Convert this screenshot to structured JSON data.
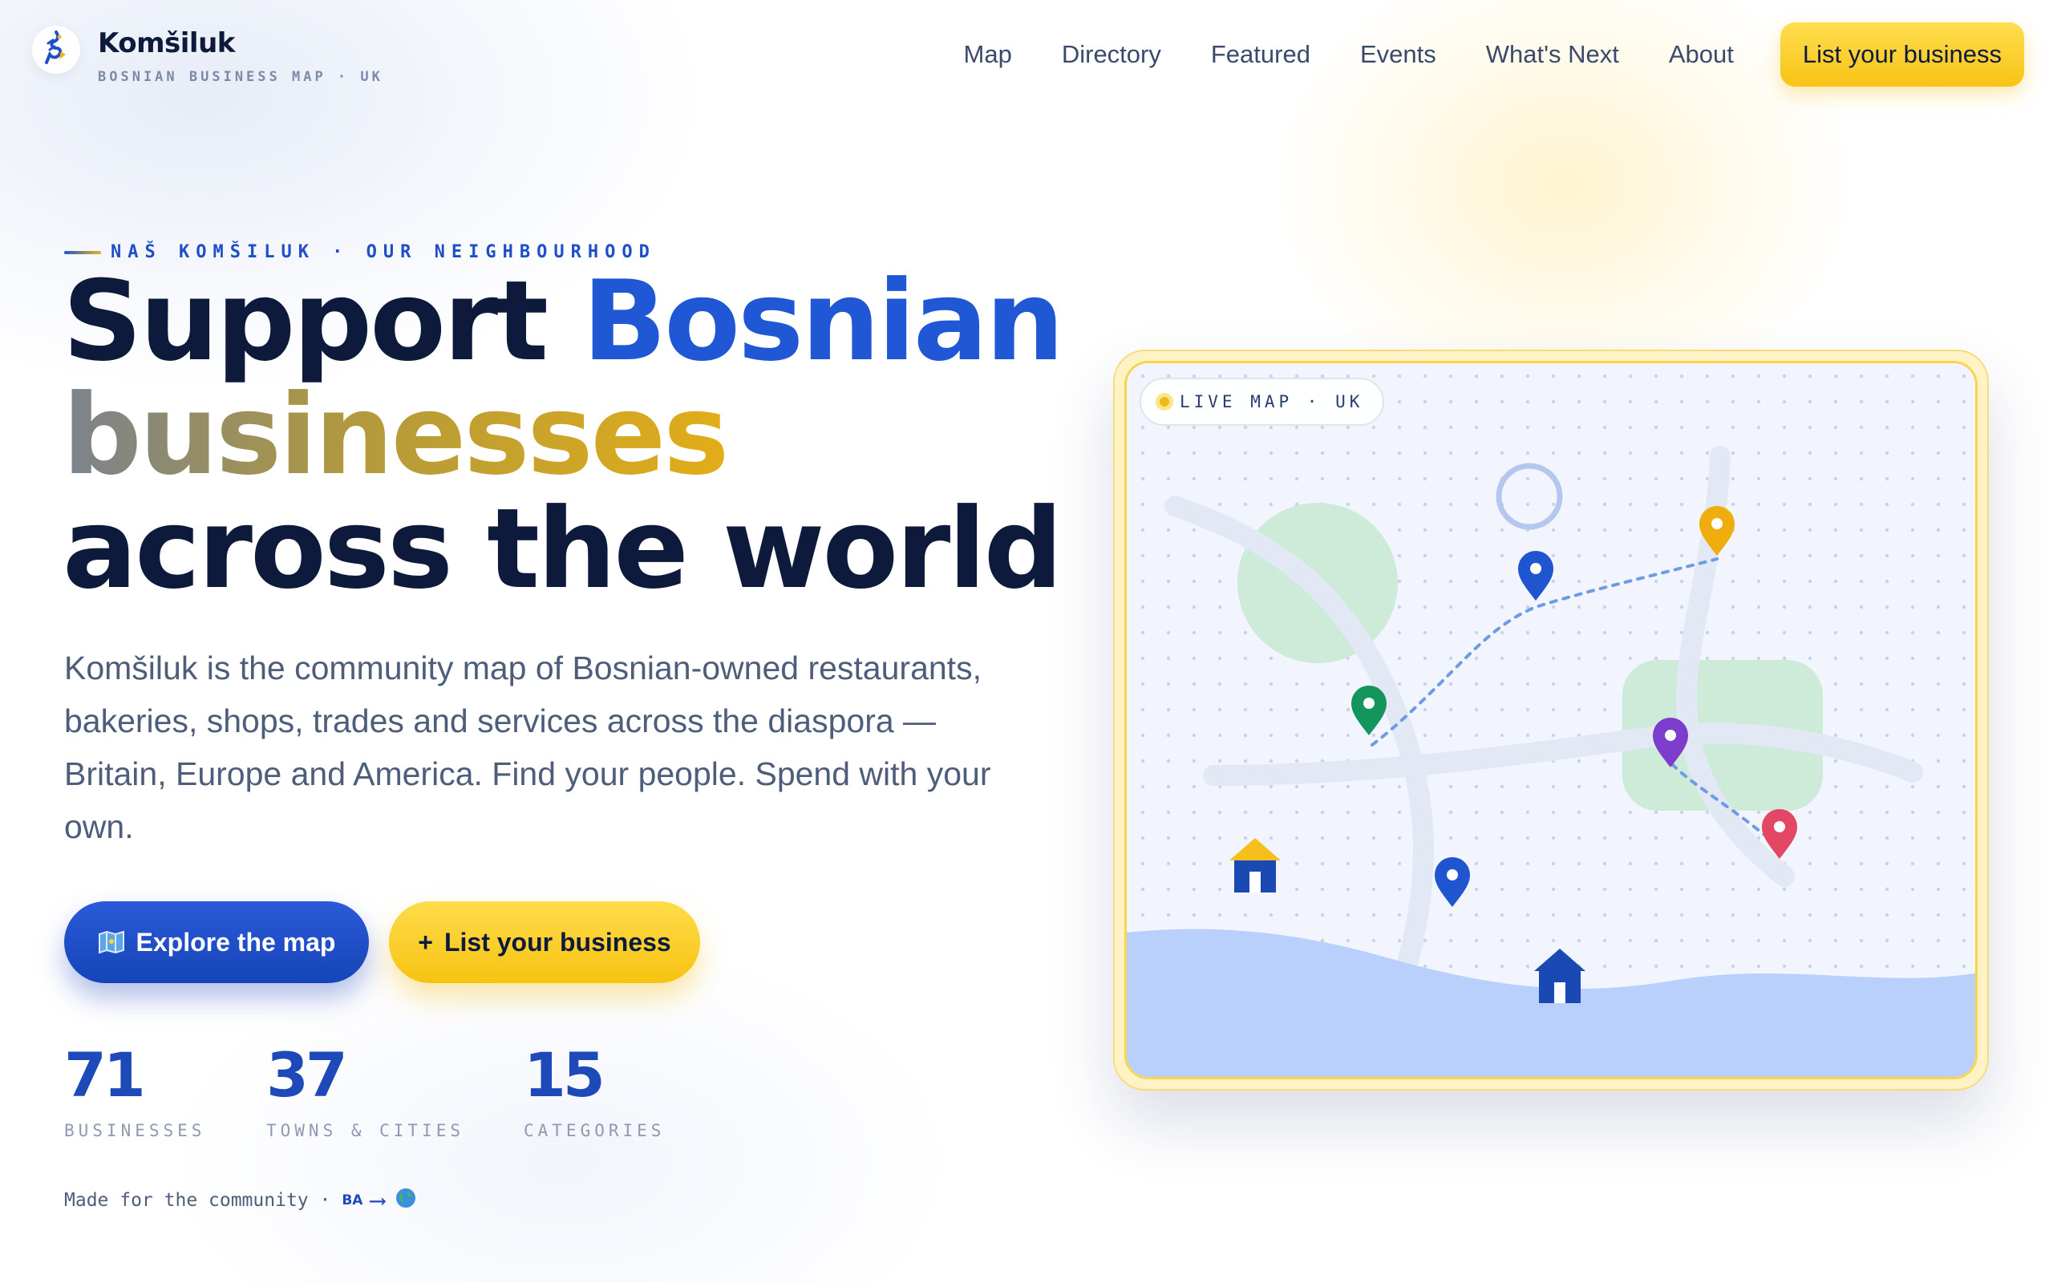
{
  "brand": {
    "name": "Komšiluk",
    "tagline": "BOSNIAN BUSINESS MAP · UK"
  },
  "nav": {
    "items": [
      {
        "label": "Map"
      },
      {
        "label": "Directory"
      },
      {
        "label": "Featured"
      },
      {
        "label": "Events"
      },
      {
        "label": "What's Next"
      },
      {
        "label": "About"
      }
    ],
    "cta_label": "List your business"
  },
  "hero": {
    "eyebrow": "NAŠ KOMŠILUK · OUR NEIGHBOURHOOD",
    "headline_part1": "Support ",
    "headline_highlight1": "Bosnian",
    "headline_highlight2": "businesses",
    "headline_part2": " across the world",
    "lead": "Komšiluk is the community map of Bosnian-owned restaurants, bakeries, shops, trades and services across the diaspora — Britain, Europe and America. Find your people. Spend with your own.",
    "primary_button": "Explore the map",
    "secondary_button": "List your business",
    "secondary_button_prefix": "+"
  },
  "stats": [
    {
      "value": "71",
      "label": "BUSINESSES"
    },
    {
      "value": "37",
      "label": "TOWNS & CITIES"
    },
    {
      "value": "15",
      "label": "CATEGORIES"
    }
  ],
  "credit": {
    "text": "Made for the community ·",
    "from_code": "BA",
    "arrow": "⟶",
    "globe_icon": "globe-icon"
  },
  "map_card": {
    "badge": "LIVE MAP · UK",
    "pins": [
      {
        "color": "#f0ad0e",
        "name": "yellow"
      },
      {
        "color": "#1f55cf",
        "name": "blue"
      },
      {
        "color": "#13955b",
        "name": "green"
      },
      {
        "color": "#7c3ccc",
        "name": "purple"
      },
      {
        "color": "#e24763",
        "name": "red"
      },
      {
        "color": "#1f55cf",
        "name": "blue"
      }
    ]
  },
  "colors": {
    "accent_blue": "#1f57d4",
    "accent_yellow": "#f7c312",
    "text_dark": "#0e1a3c"
  }
}
